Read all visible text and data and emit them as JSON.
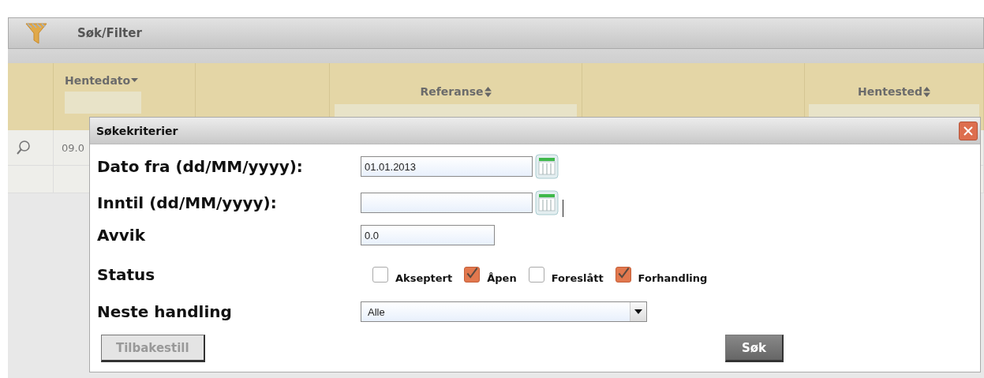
{
  "toolbar": {
    "label": "Søk/Filter"
  },
  "table": {
    "columns": [
      {
        "label": "Hentedato",
        "sorted": true,
        "filter": true
      },
      {
        "label": "Referanse",
        "sorted": false,
        "filter": true
      },
      {
        "label": "Hentested",
        "sorted": false,
        "filter": true
      }
    ],
    "rows": [
      {
        "column_1": "09.0"
      }
    ]
  },
  "dialog": {
    "title": "Søkekriterier",
    "fields": [
      {
        "kind": "date",
        "label": "Dato fra (dd/MM/yyyy):",
        "value": "01.01.2013"
      },
      {
        "kind": "date",
        "label": "Inntil (dd/MM/yyyy):",
        "focused": true
      },
      {
        "kind": "text",
        "label": "Avvik",
        "value": "0.0"
      },
      {
        "kind": "checks",
        "label": "Status",
        "options": [
          {
            "label": "Akseptert",
            "checked": false
          },
          {
            "label": "Åpen",
            "checked": true
          },
          {
            "label": "Foreslått",
            "checked": false
          },
          {
            "label": "Forhandling",
            "checked": true
          }
        ]
      },
      {
        "kind": "select",
        "label": "Neste handling",
        "value": "Alle"
      }
    ],
    "buttons": [
      {
        "label": "Tilbakestill",
        "disabled": true
      },
      {
        "label": "Søk",
        "disabled": false
      }
    ]
  }
}
